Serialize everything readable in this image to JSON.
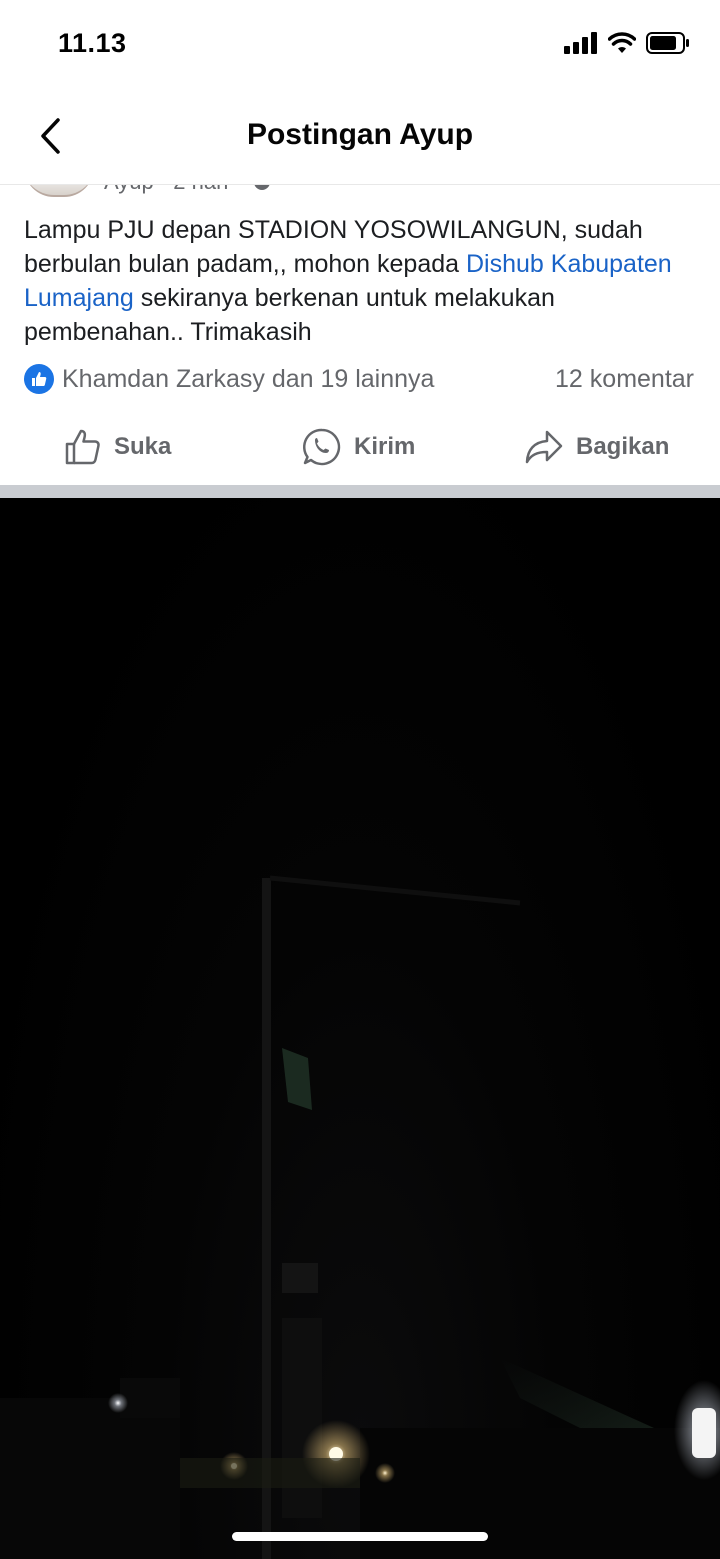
{
  "status_bar": {
    "time": "11.13"
  },
  "nav": {
    "title": "Postingan Ayup"
  },
  "post": {
    "author_meta": "Ayup · 2 hari ·",
    "text_part1": "Lampu PJU depan STADION YOSOWILANGUN, sudah berbulan bulan padam,, mohon kepada ",
    "mention": "Dishub Kabupaten Lumajang",
    "text_part2": " sekiranya berkenan untuk melakukan pembenahan.. Trimakasih",
    "reactions_text": "Khamdan Zarkasy dan 19 lainnya",
    "comments_text": "12 komentar"
  },
  "actions": {
    "like_label": "Suka",
    "send_label": "Kirim",
    "share_label": "Bagikan"
  },
  "colors": {
    "link": "#1a63c7",
    "like_badge": "#1b74e4"
  }
}
